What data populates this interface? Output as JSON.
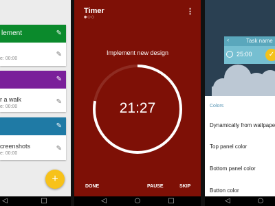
{
  "list_screen": {
    "cards": [
      {
        "title": "lement",
        "color": "#0b8a2c",
        "item": "",
        "time": "e: 00:00"
      },
      {
        "title": "",
        "color": "#7a1f9a",
        "item": "r a walk",
        "time": "e: 00:00"
      },
      {
        "title": "",
        "color": "#1f7aa5",
        "item": "creenshots",
        "time": "e: 00:00"
      }
    ],
    "fab_label": "+",
    "fab_color": "#f7c21a"
  },
  "timer_screen": {
    "title": "Timer",
    "pager_dots": "●○○",
    "menu_icon": "⋮",
    "task": "Implement new design",
    "time": "21:27",
    "progress": 0.78,
    "done_label": "DONE",
    "pause_label": "PAUSE",
    "skip_label": "SKIP",
    "background": "#7e1006"
  },
  "settings_screen": {
    "preview_task_name": "Task name",
    "preview_time": "25:00",
    "section_label": "Colors",
    "options": [
      "Dynamically from wallpaper",
      "Top panel color",
      "Bottom panel color",
      "Button color"
    ]
  },
  "nav": {
    "back": "◁",
    "home": "○",
    "recents": "□"
  }
}
